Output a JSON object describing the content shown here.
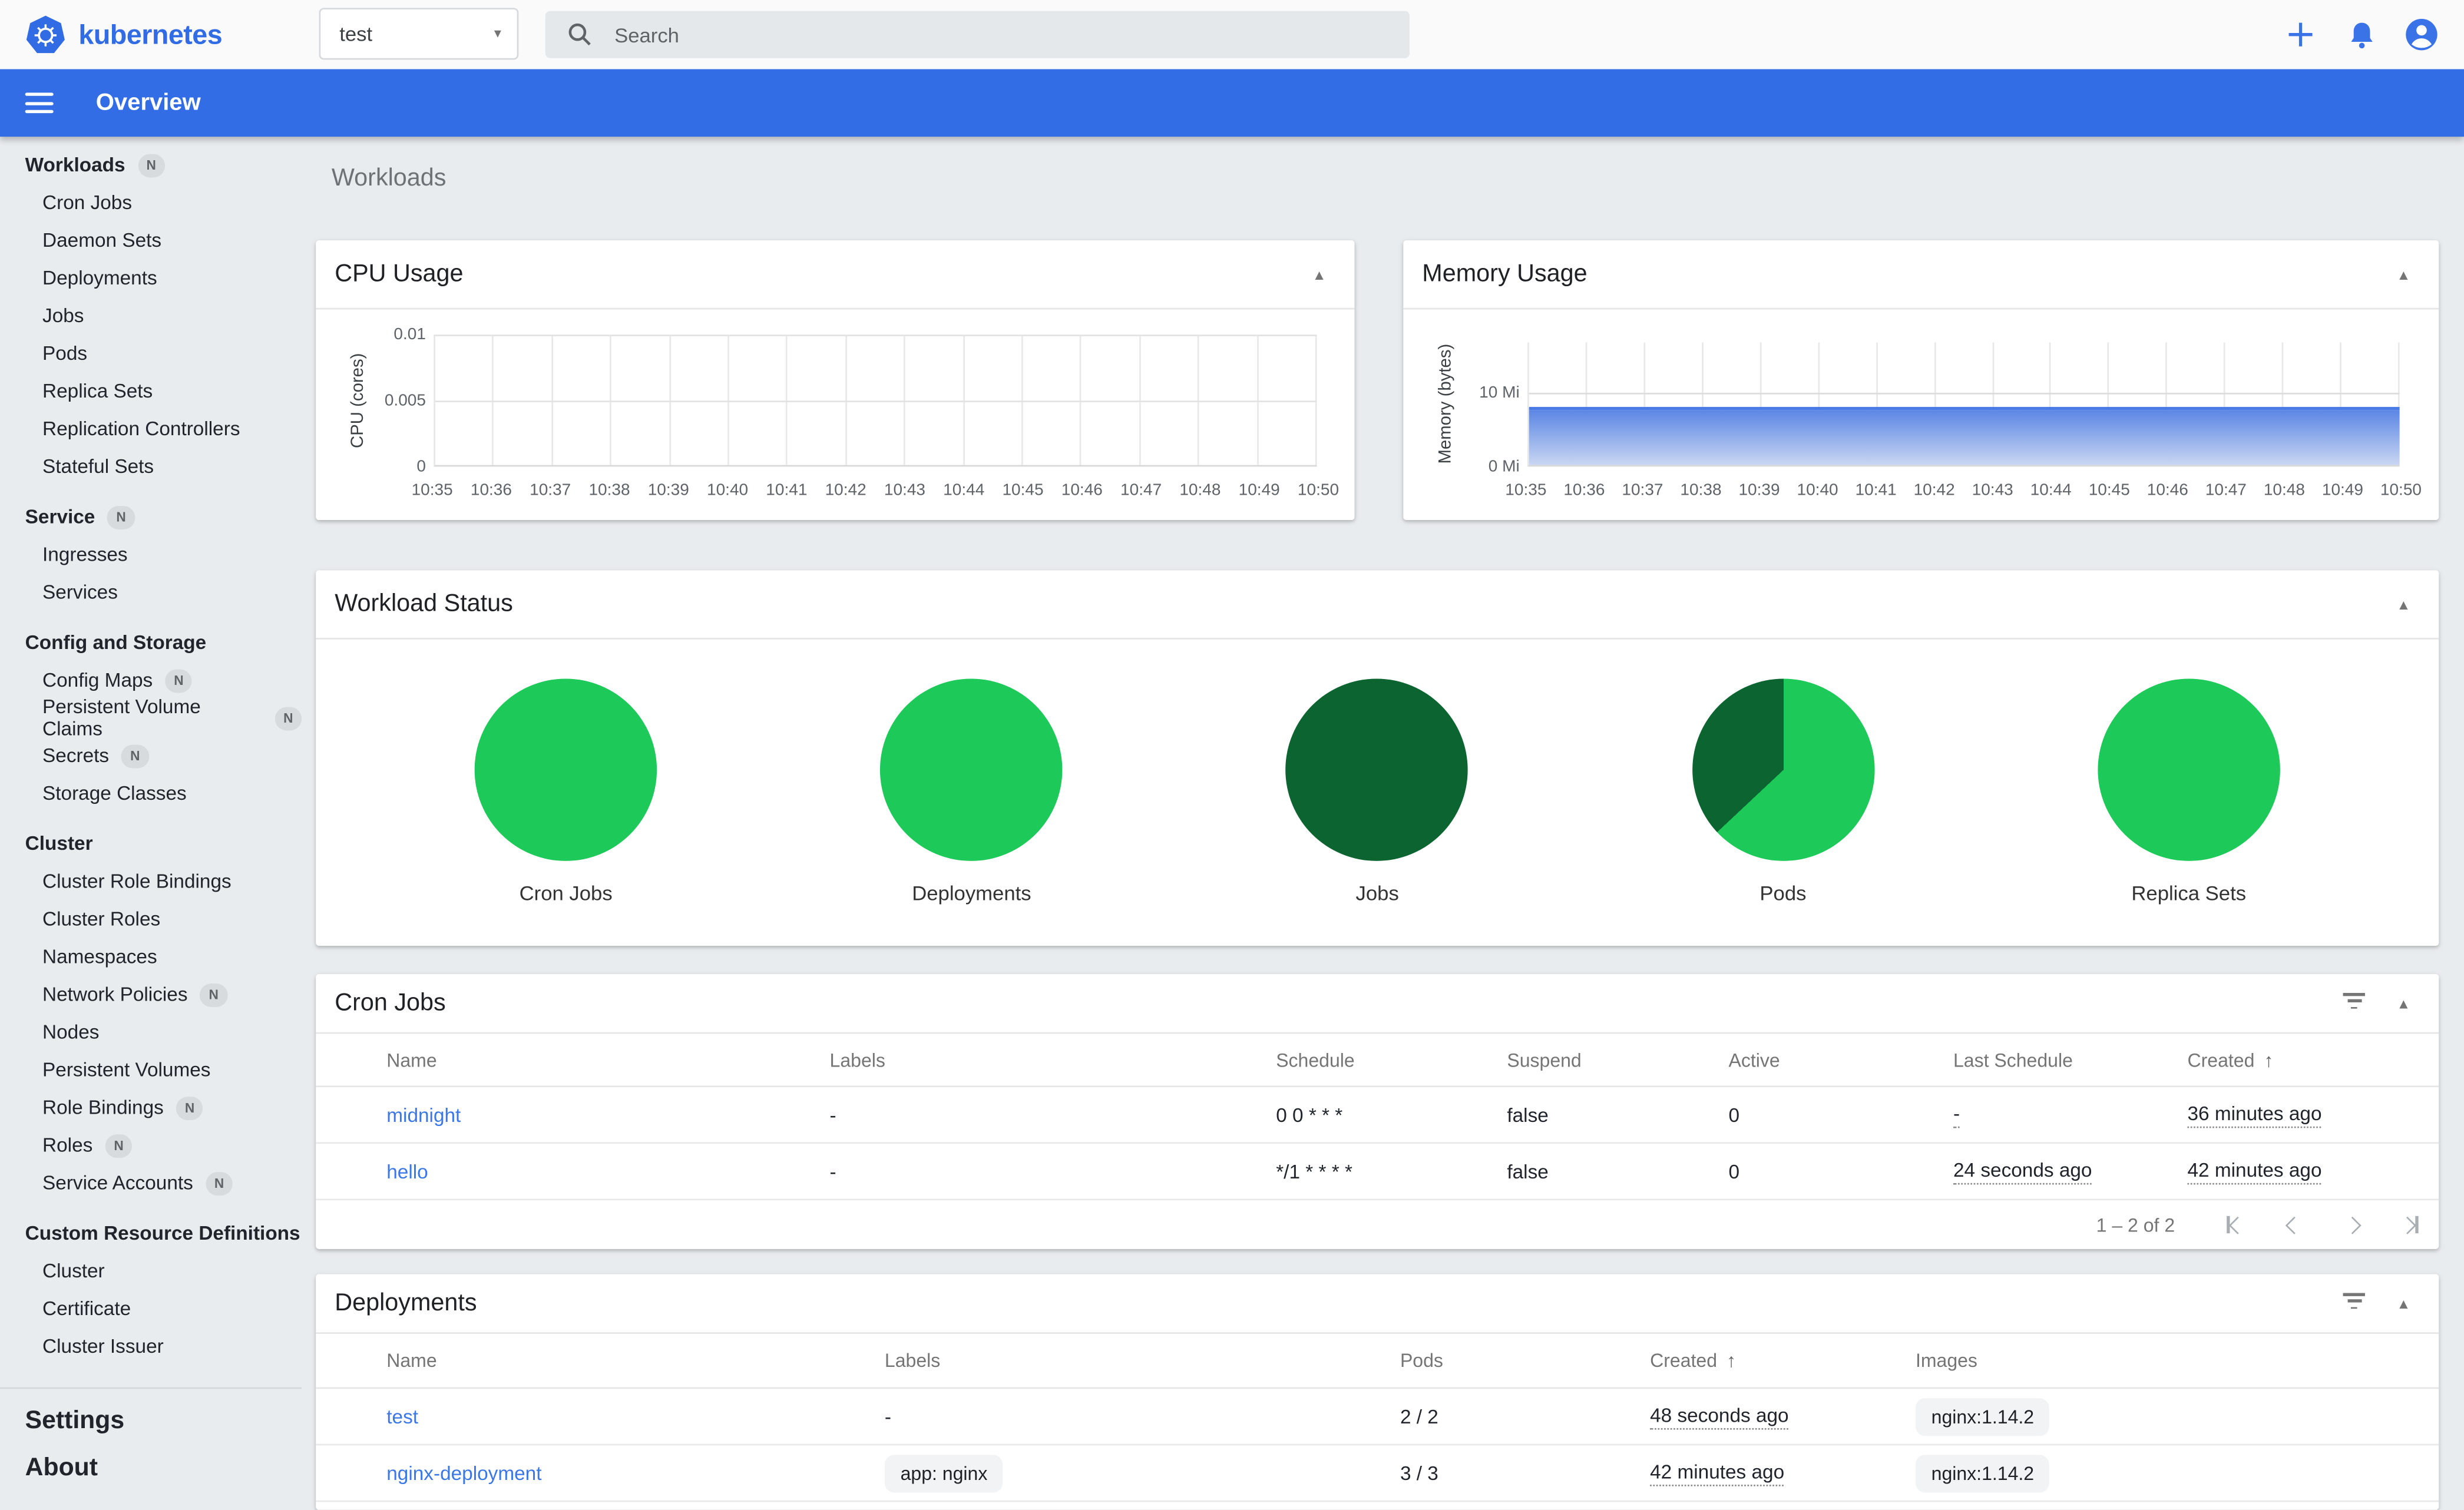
{
  "icons": {
    "dropdown": "▾",
    "collapse": "▲",
    "sort_asc": "↑",
    "more": "vertical-kebab",
    "filter": "filter-list",
    "status_ok": "check-circle",
    "search": "magnifier",
    "add": "plus",
    "notifications": "bell",
    "account": "person-circle",
    "menu": "hamburger"
  },
  "colors": {
    "appbar_blue": "#326de6",
    "brand_blue": "#326ce5",
    "link_blue": "#3b78e7",
    "success_green": "#188a1e",
    "pie_ok_green": "#1dc958",
    "pie_dark_green": "#0c6530",
    "memory_fill_top": "#5b86e4",
    "memory_fill_bottom": "#c9d6f2"
  },
  "header": {
    "logo_text": "kubernetes",
    "namespace": {
      "value": "test"
    },
    "search": {
      "placeholder": "Search"
    }
  },
  "appbar": {
    "title": "Overview"
  },
  "sidebar": {
    "entries": [
      {
        "header": true,
        "label": "Workloads",
        "badge": "N"
      },
      {
        "item": true,
        "label": "Cron Jobs"
      },
      {
        "item": true,
        "label": "Daemon Sets"
      },
      {
        "item": true,
        "label": "Deployments"
      },
      {
        "item": true,
        "label": "Jobs"
      },
      {
        "item": true,
        "label": "Pods"
      },
      {
        "item": true,
        "label": "Replica Sets"
      },
      {
        "item": true,
        "label": "Replication Controllers"
      },
      {
        "item": true,
        "label": "Stateful Sets"
      },
      {
        "header": true,
        "label": "Service",
        "badge": "N"
      },
      {
        "item": true,
        "label": "Ingresses"
      },
      {
        "item": true,
        "label": "Services"
      },
      {
        "header": true,
        "label": "Config and Storage"
      },
      {
        "item": true,
        "label": "Config Maps",
        "badge": "N"
      },
      {
        "item": true,
        "label": "Persistent Volume Claims",
        "badge": "N"
      },
      {
        "item": true,
        "label": "Secrets",
        "badge": "N"
      },
      {
        "item": true,
        "label": "Storage Classes"
      },
      {
        "header": true,
        "label": "Cluster"
      },
      {
        "item": true,
        "label": "Cluster Role Bindings"
      },
      {
        "item": true,
        "label": "Cluster Roles"
      },
      {
        "item": true,
        "label": "Namespaces"
      },
      {
        "item": true,
        "label": "Network Policies",
        "badge": "N"
      },
      {
        "item": true,
        "label": "Nodes"
      },
      {
        "item": true,
        "label": "Persistent Volumes"
      },
      {
        "item": true,
        "label": "Role Bindings",
        "badge": "N"
      },
      {
        "item": true,
        "label": "Roles",
        "badge": "N"
      },
      {
        "item": true,
        "label": "Service Accounts",
        "badge": "N"
      },
      {
        "header": true,
        "label": "Custom Resource Definitions"
      },
      {
        "item": true,
        "label": "Cluster"
      },
      {
        "item": true,
        "label": "Certificate"
      },
      {
        "item": true,
        "label": "Cluster Issuer"
      }
    ],
    "footer_items": [
      {
        "label": "Settings"
      },
      {
        "label": "About"
      }
    ]
  },
  "page": {
    "title": "Workloads"
  },
  "cpu_card": {
    "title": "CPU Usage",
    "ylabel": "CPU (cores)",
    "yticks": [
      "0.01",
      "0.005",
      "0"
    ],
    "xticks": [
      "10:35",
      "10:36",
      "10:37",
      "10:38",
      "10:39",
      "10:40",
      "10:41",
      "10:42",
      "10:43",
      "10:44",
      "10:45",
      "10:46",
      "10:47",
      "10:48",
      "10:49",
      "10:50"
    ],
    "series": []
  },
  "memory_card": {
    "title": "Memory Usage",
    "ylabel": "Memory (bytes)",
    "yticks": [
      "10 Mi",
      "0 Mi"
    ],
    "xticks": [
      "10:35",
      "10:36",
      "10:37",
      "10:38",
      "10:39",
      "10:40",
      "10:41",
      "10:42",
      "10:43",
      "10:44",
      "10:45",
      "10:46",
      "10:47",
      "10:48",
      "10:49",
      "10:50"
    ],
    "series_value": "~8 Mi (flat)"
  },
  "workload_status": {
    "title": "Workload Status",
    "pies": [
      {
        "label": "Cron Jobs",
        "slices": [
          {
            "color": "#1dc958",
            "pct": 100
          }
        ]
      },
      {
        "label": "Deployments",
        "slices": [
          {
            "color": "#1dc958",
            "pct": 100
          }
        ]
      },
      {
        "label": "Jobs",
        "slices": [
          {
            "color": "#0c6530",
            "pct": 100
          }
        ]
      },
      {
        "label": "Pods",
        "slices": [
          {
            "color": "#1dc958",
            "pct": 63
          },
          {
            "color": "#0c6530",
            "pct": 37
          }
        ]
      },
      {
        "label": "Replica Sets",
        "slices": [
          {
            "color": "#1dc958",
            "pct": 100
          }
        ]
      }
    ]
  },
  "cron_jobs": {
    "title": "Cron Jobs",
    "columns": {
      "name": "Name",
      "labels": "Labels",
      "schedule": "Schedule",
      "suspend": "Suspend",
      "active": "Active",
      "last_schedule": "Last Schedule",
      "created": "Created"
    },
    "rows": [
      {
        "name": "midnight",
        "labels": "-",
        "schedule": "0 0 * * *",
        "suspend": "false",
        "active": "0",
        "last_schedule": "-",
        "created": "36 minutes ago"
      },
      {
        "name": "hello",
        "labels": "-",
        "schedule": "*/1 * * * *",
        "suspend": "false",
        "active": "0",
        "last_schedule": "24 seconds ago",
        "created": "42 minutes ago"
      }
    ],
    "pagination": {
      "range": "1 – 2 of 2"
    }
  },
  "deployments": {
    "title": "Deployments",
    "columns": {
      "name": "Name",
      "labels": "Labels",
      "pods": "Pods",
      "created": "Created",
      "images": "Images"
    },
    "rows": [
      {
        "name": "test",
        "label_text": "-",
        "pods": "2 / 2",
        "created": "48 seconds ago",
        "image": "nginx:1.14.2"
      },
      {
        "name": "nginx-deployment",
        "label_chip": "app: nginx",
        "pods": "3 / 3",
        "created": "42 minutes ago",
        "image": "nginx:1.14.2"
      }
    ]
  }
}
